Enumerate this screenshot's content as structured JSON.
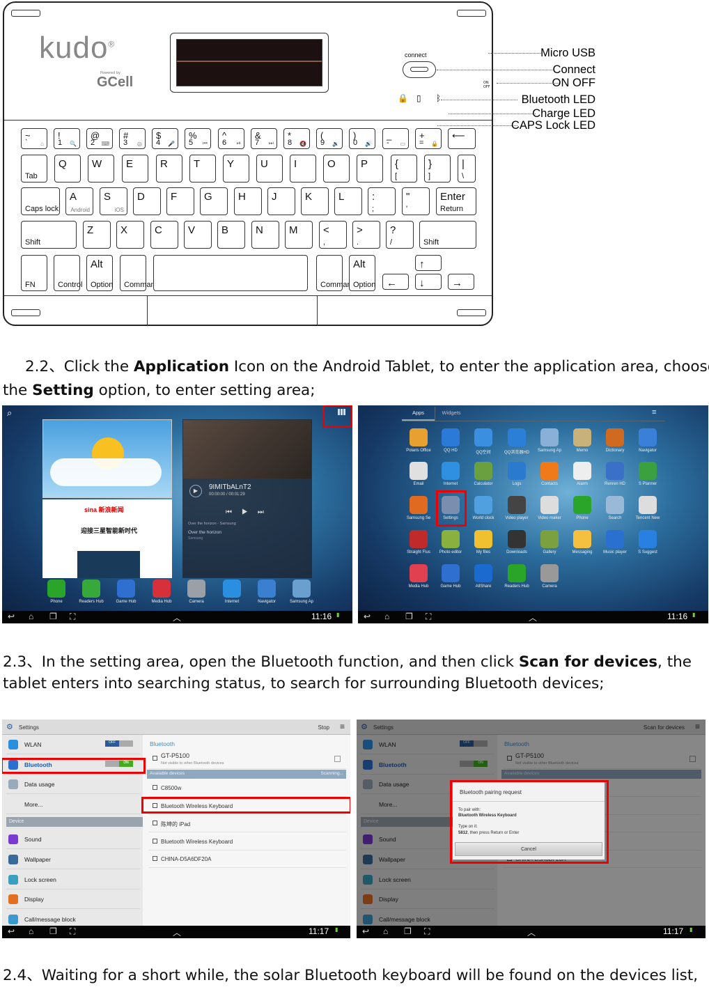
{
  "keyboard": {
    "brand": "kudo",
    "brand_mark": "®",
    "powered_by": "Powered by",
    "gcell": "GCell",
    "connect_label": "connect",
    "on_label": "ON",
    "off_label": "OFF",
    "callouts": [
      "Micro USB",
      "Connect",
      "ON OFF",
      "Bluetooth LED",
      "Charge LED",
      "CAPS Lock LED"
    ],
    "rows": [
      [
        [
          "~",
          "`",
          "⌂"
        ],
        [
          "!",
          "1",
          "🔍"
        ],
        [
          "@",
          "2",
          "⌨"
        ],
        [
          "#",
          "3",
          "◎"
        ],
        [
          "$",
          "4",
          "🎤"
        ],
        [
          "%",
          "5",
          "⏮"
        ],
        [
          "^",
          "6",
          "⏯"
        ],
        [
          "&",
          "7",
          "⏭"
        ],
        [
          "*",
          "8",
          "🔇"
        ],
        [
          "(",
          "9",
          "🔉"
        ],
        [
          ")",
          "0",
          "🔊"
        ],
        [
          "_",
          "-",
          "▭"
        ],
        [
          "+",
          "=",
          "🔒"
        ],
        [
          "⟵",
          "",
          ""
        ]
      ],
      [
        [
          "",
          "Tab",
          ""
        ],
        [
          "Q",
          "",
          ""
        ],
        [
          "W",
          "",
          ""
        ],
        [
          "E",
          "",
          ""
        ],
        [
          "R",
          "",
          ""
        ],
        [
          "T",
          "",
          ""
        ],
        [
          "Y",
          "",
          ""
        ],
        [
          "U",
          "",
          ""
        ],
        [
          "I",
          "",
          ""
        ],
        [
          "O",
          "",
          ""
        ],
        [
          "P",
          "",
          ""
        ],
        [
          "{",
          "[",
          ""
        ],
        [
          "}",
          "]",
          ""
        ],
        [
          "|",
          "\\",
          ""
        ]
      ],
      [
        [
          "",
          "Caps lock",
          ""
        ],
        [
          "A",
          "",
          "Android"
        ],
        [
          "S",
          "",
          "iOS"
        ],
        [
          "D",
          "",
          ""
        ],
        [
          "F",
          "",
          ""
        ],
        [
          "G",
          "",
          ""
        ],
        [
          "H",
          "",
          ""
        ],
        [
          "J",
          "",
          ""
        ],
        [
          "K",
          "",
          ""
        ],
        [
          "L",
          "",
          ""
        ],
        [
          ":",
          ";",
          ""
        ],
        [
          "\"",
          "'",
          ""
        ],
        [
          "Enter",
          "Return",
          ""
        ]
      ],
      [
        [
          "",
          "Shift",
          ""
        ],
        [
          "Z",
          "",
          ""
        ],
        [
          "X",
          "",
          ""
        ],
        [
          "C",
          "",
          ""
        ],
        [
          "V",
          "",
          ""
        ],
        [
          "B",
          "",
          ""
        ],
        [
          "N",
          "",
          ""
        ],
        [
          "M",
          "",
          ""
        ],
        [
          "<",
          ",",
          ""
        ],
        [
          ">",
          ".",
          ""
        ],
        [
          "?",
          "/",
          ""
        ],
        [
          "",
          "Shift",
          ""
        ]
      ],
      [
        [
          "",
          "FN",
          ""
        ],
        [
          "",
          "Control",
          ""
        ],
        [
          "Alt",
          "Option",
          ""
        ],
        [
          "",
          "Command",
          ""
        ],
        [
          "",
          "",
          ""
        ],
        [
          "",
          "Command",
          ""
        ],
        [
          "Alt",
          "Option",
          ""
        ],
        [
          "←",
          "",
          ""
        ],
        [
          "↑",
          "",
          ""
        ],
        [
          "↓",
          "",
          ""
        ],
        [
          "→",
          "",
          ""
        ]
      ]
    ]
  },
  "paragraphs": {
    "p22": {
      "prefix": "2.2、Click the ",
      "b1": "Application",
      "mid": " Icon on the Android Tablet, to enter the application area, choose",
      "line2_pre": "the ",
      "b2": "Setting",
      "line2_post": " option, to enter setting area;"
    },
    "p23": {
      "prefix": "2.3、In the setting area, open the Bluetooth function, and then click ",
      "b1": "Scan for devices",
      "post": ", the",
      "line2": "tablet enters into searching status, to search for surrounding Bluetooth devices;"
    },
    "p24": {
      "text": "2.4、Waiting for a short while, the solar Bluetooth keyboard will be found on the devices list,"
    }
  },
  "home": {
    "time": "11:16",
    "video_title": "9IMITbALnT2",
    "video_time": "00:00:00 / 00:01:29",
    "music_line": "Over the horizon - Samsung",
    "track": "Over the horizon",
    "artist": "Samsung",
    "news_title": "迎接三星智能新时代",
    "news_brand": "sina 新浪新闻",
    "dock": [
      "Phone",
      "Readers Hub",
      "Game Hub",
      "Media Hub",
      "Camera",
      "Internet",
      "Navigator",
      "Samsung Ap"
    ],
    "dock_colors": [
      "#2aa52a",
      "#37a83a",
      "#2f6fd0",
      "#d8303a",
      "#9aa0a6",
      "#2a8fe0",
      "#3a7fd0",
      "#6aa0d0"
    ]
  },
  "apps": {
    "time": "11:16",
    "tabs": [
      "Apps",
      "Widgets"
    ],
    "items": [
      "Polaris Office",
      "QQ HD",
      "QQ空间",
      "QQ浏览器HD",
      "Samsung Ap",
      "Memo",
      "Dictionary",
      "Navigator",
      "Email",
      "Internet",
      "Calculator",
      "Logs",
      "Contacts",
      "Alarm",
      "Renren HD",
      "S Planner",
      "Samsung Se",
      "Settings",
      "World clock",
      "Video player",
      "Video maker",
      "Phone",
      "Search",
      "Tencent New",
      "Straight Flus",
      "Photo editor",
      "My files",
      "Downloads",
      "Gallery",
      "Messaging",
      "Music player",
      "S Suggest",
      "Media Hub",
      "Game Hub",
      "AllShare",
      "Readers Hub",
      "Camera"
    ],
    "colors": [
      "#e8a030",
      "#2b7ad8",
      "#3a8fe0",
      "#2c7fd6",
      "#8ab0d8",
      "#c9b27a",
      "#d06a20",
      "#3a80d8",
      "#e0e0e0",
      "#2f8fe0",
      "#6aa040",
      "#2a7ad0",
      "#f07a1a",
      "#eeeeee",
      "#3a70c8",
      "#3aa040",
      "#e06a20",
      "#7a8fb0",
      "#50a0e0",
      "#444",
      "#ddd",
      "#2aa52a",
      "#9ab8d8",
      "#ddd",
      "#c02a2a",
      "#8ab040",
      "#f0c030",
      "#333",
      "#7aa040",
      "#f5c040",
      "#2a70d0",
      "#2a80e0",
      "#e04050",
      "#2f6fd0",
      "#1a6ad0",
      "#2aa52a",
      "#999"
    ]
  },
  "settings": {
    "time": "11:17",
    "title": "Settings",
    "stop": "Stop",
    "scan": "Scan for devices",
    "left": [
      {
        "label": "WLAN",
        "toggle": "OFF",
        "color": "#2a8fe0"
      },
      {
        "label": "Bluetooth",
        "toggle": "ON",
        "color": "#2a70d0"
      },
      {
        "label": "Data usage",
        "color": "#9ab"
      },
      {
        "label": "More...",
        "color": ""
      },
      {
        "header": "Device"
      },
      {
        "label": "Sound",
        "color": "#7a3ad0"
      },
      {
        "label": "Wallpaper",
        "color": "#3a6a9a"
      },
      {
        "label": "Lock screen",
        "color": "#3aa0c0"
      },
      {
        "label": "Display",
        "color": "#e07020"
      },
      {
        "label": "Call/message block",
        "color": "#3a9ad0"
      }
    ],
    "bt_header": "Bluetooth",
    "my_device": "GT-P5100",
    "my_sub": "Not visible to other Bluetooth devices",
    "available": "Available devices",
    "scanning": "Scanning...",
    "devices": [
      "C8500w",
      "Bluetooth Wireless Keyboard",
      "陈坤的 iPad",
      "Bluetooth Wireless Keyboard",
      "CHINA-D5A6DF20A"
    ],
    "dialog": {
      "title": "Bluetooth pairing request",
      "pair_with": "To pair with:",
      "device": "Bluetooth Wireless Keyboard",
      "type_on": "Type on it:",
      "code": "5812",
      "code_suffix": ", then press Return or Enter",
      "cancel": "Cancel"
    }
  }
}
